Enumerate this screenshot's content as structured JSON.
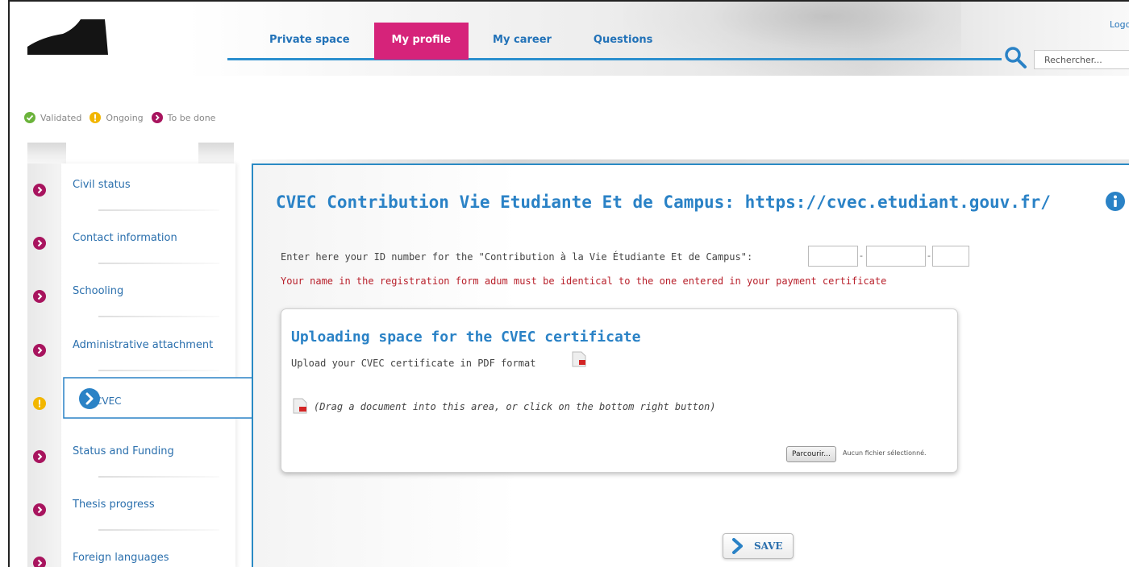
{
  "header": {
    "nav": [
      {
        "label": "Private space",
        "active": false
      },
      {
        "label": "My profile",
        "active": true
      },
      {
        "label": "My career",
        "active": false
      },
      {
        "label": "Questions",
        "active": false
      }
    ],
    "search_placeholder": "Rechercher...",
    "login_label": "Logo"
  },
  "legend": {
    "validated": "Validated",
    "ongoing": "Ongoing",
    "todo": "To be done"
  },
  "colors": {
    "brand_blue": "#2a82c6",
    "accent_pink": "#d6237a",
    "status_todo": "#a8145e",
    "status_ongoing": "#f2b600",
    "status_validated": "#6bb33b",
    "warning_red": "#b8202b"
  },
  "menu": {
    "items": [
      {
        "label": "Civil status",
        "status": "todo"
      },
      {
        "label": "Contact information",
        "status": "todo"
      },
      {
        "label": "Schooling",
        "status": "todo"
      },
      {
        "label": "Administrative attachment",
        "status": "todo"
      },
      {
        "label": "CVEC",
        "status": "ongoing",
        "active": true
      },
      {
        "label": "Status and Funding",
        "status": "todo"
      },
      {
        "label": "Thesis progress",
        "status": "todo"
      },
      {
        "label": "Foreign languages",
        "status": "todo"
      }
    ]
  },
  "main": {
    "title": "CVEC Contribution Vie Etudiante Et de Campus: https://cvec.etudiant.gouv.fr/",
    "id_label": "Enter here your ID number for the \"Contribution à la Vie Étudiante Et de Campus\":",
    "id_values": [
      "",
      "",
      ""
    ],
    "warning": "Your name in the registration form adum must be identical to the one entered in your payment certificate",
    "upload": {
      "title": "Uploading space for the CVEC certificate",
      "hint": "Upload your CVEC certificate in PDF format",
      "drop_text": "(Drag a document into this area, or click on the bottom right button)",
      "browse_label": "Parcourir...",
      "no_file": "Aucun fichier sélectionné."
    },
    "save_label": "SAVE"
  }
}
